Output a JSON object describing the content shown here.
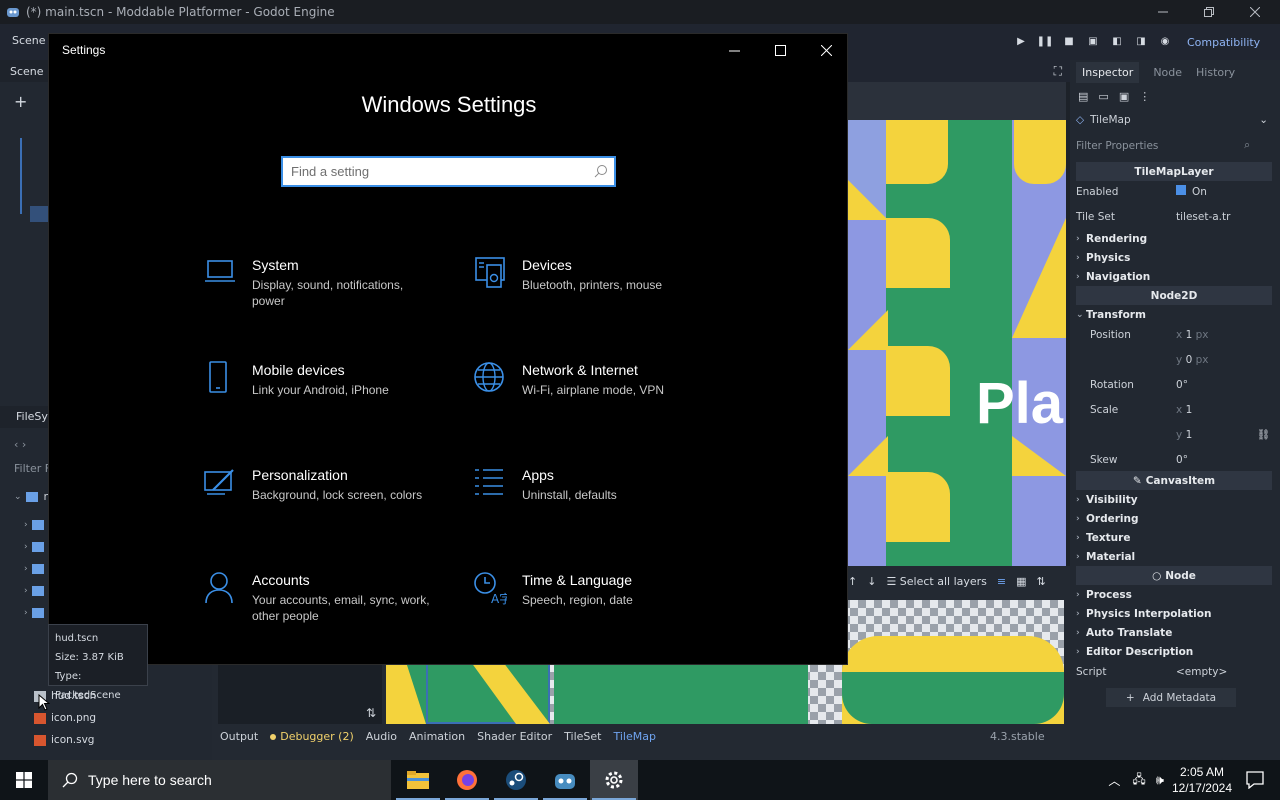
{
  "window": {
    "title": "(*) main.tscn - Moddable Platformer - Godot Engine"
  },
  "godot_menu": {
    "scene_menu": "Scene",
    "renderer": "Compatibility"
  },
  "left_dock": {
    "scene_tab": "Scene",
    "filesystem_tab": "FileSys",
    "filter_label": "Filter Fi",
    "root_folder": "r",
    "files": [
      {
        "name": "hud.tscn",
        "type": "scene"
      },
      {
        "name": "icon.png",
        "type": "image"
      },
      {
        "name": "icon.svg",
        "type": "image"
      }
    ]
  },
  "tooltip": {
    "name": "hud.tscn",
    "size": "Size: 3.87 KiB",
    "type": "Type: PackedScene"
  },
  "viewport": {
    "overlay_text": "Pla"
  },
  "bottom_toolbar": {
    "select_all_layers": "Select all layers"
  },
  "bottom_tabs": {
    "output": "Output",
    "debugger": "Debugger (2)",
    "audio": "Audio",
    "animation": "Animation",
    "shader_editor": "Shader Editor",
    "tileset": "TileSet",
    "tilemap": "TileMap",
    "version": "4.3.stable"
  },
  "inspector": {
    "tabs": {
      "inspector": "Inspector",
      "node": "Node",
      "history": "History"
    },
    "node_type": "TileMap",
    "filter_placeholder": "Filter Properties",
    "sections": {
      "tilemaplayer": "TileMapLayer",
      "enabled": "Enabled",
      "enabled_value": "On",
      "tile_set": "Tile Set",
      "tile_set_value": "tileset-a.tr",
      "rendering": "Rendering",
      "physics": "Physics",
      "navigation": "Navigation",
      "node2d": "Node2D",
      "transform": "Transform",
      "position": "Position",
      "pos_x": "1",
      "pos_y": "0",
      "px": "px",
      "rotation": "Rotation",
      "rotation_value": "0",
      "scale": "Scale",
      "scale_x": "1",
      "scale_y": "1",
      "skew": "Skew",
      "skew_value": "0",
      "canvasitem": "CanvasItem",
      "visibility": "Visibility",
      "ordering": "Ordering",
      "texture": "Texture",
      "material": "Material",
      "node": "Node",
      "process": "Process",
      "physics_interpolation": "Physics Interpolation",
      "auto_translate": "Auto Translate",
      "editor_description": "Editor Description",
      "script": "Script",
      "script_value": "<empty>",
      "add_metadata": "Add Metadata"
    }
  },
  "settings": {
    "window_title": "Settings",
    "heading": "Windows Settings",
    "search_placeholder": "Find a setting",
    "items": [
      {
        "name": "System",
        "desc": "Display, sound, notifications, power",
        "icon": "laptop-icon"
      },
      {
        "name": "Devices",
        "desc": "Bluetooth, printers, mouse",
        "icon": "devices-icon"
      },
      {
        "name": "Mobile devices",
        "desc": "Link your Android, iPhone",
        "icon": "phone-icon"
      },
      {
        "name": "Network & Internet",
        "desc": "Wi-Fi, airplane mode, VPN",
        "icon": "globe-icon"
      },
      {
        "name": "Personalization",
        "desc": "Background, lock screen, colors",
        "icon": "paint-icon"
      },
      {
        "name": "Apps",
        "desc": "Uninstall, defaults",
        "icon": "apps-list-icon"
      },
      {
        "name": "Accounts",
        "desc": "Your accounts, email, sync, work, other people",
        "icon": "person-icon"
      },
      {
        "name": "Time & Language",
        "desc": "Speech, region, date",
        "icon": "time-language-icon"
      }
    ],
    "accent_color": "#3b8fe6"
  },
  "taskbar": {
    "search_placeholder": "Type here to search",
    "time": "2:05 AM",
    "date": "12/17/2024"
  }
}
